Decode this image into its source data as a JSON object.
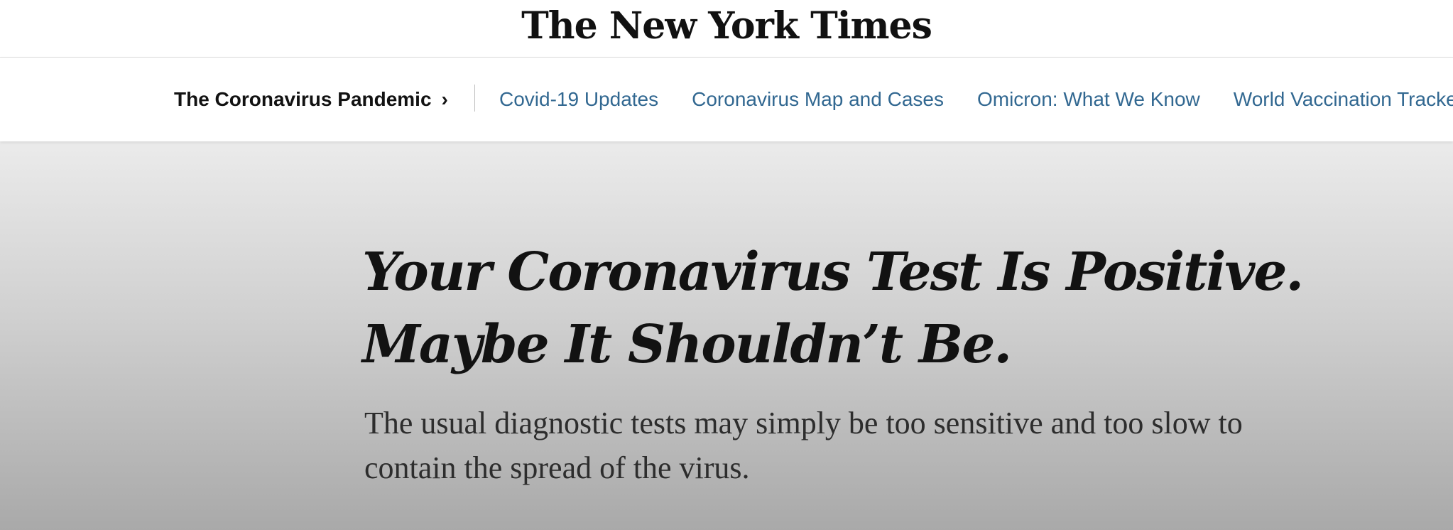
{
  "masthead": {
    "logo_text": "The New York Times"
  },
  "subnav": {
    "section_label": "The Coronavirus Pandemic",
    "chevron": "›",
    "links": [
      "Covid-19 Updates",
      "Coronavirus Map and Cases",
      "Omicron: What We Know",
      "World Vaccination Tracker"
    ]
  },
  "article": {
    "headline": "Your Coronavirus Test Is Positive. Maybe It Shouldn’t Be.",
    "summary": "The usual diagnostic tests may simply be too sensitive and too slow to contain the spread of the virus."
  },
  "colors": {
    "link": "#326891",
    "text": "#121212"
  }
}
